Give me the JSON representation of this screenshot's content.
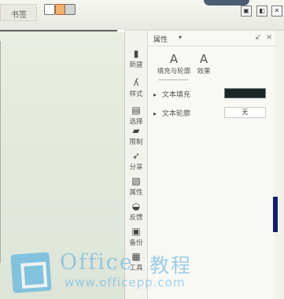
{
  "app": {
    "bookmark_tab": "书签"
  },
  "sidebar_tools": [
    {
      "label": "新建",
      "icon": "new-icon"
    },
    {
      "label": "样式",
      "icon": "style-icon"
    },
    {
      "label": "选择",
      "icon": "select-icon"
    },
    {
      "label": "限制",
      "icon": "restrict-icon"
    },
    {
      "label": "分享",
      "icon": "share-icon"
    },
    {
      "label": "属性",
      "icon": "properties-icon"
    },
    {
      "label": "反馈",
      "icon": "feedback-icon"
    },
    {
      "label": "备份",
      "icon": "backup-icon"
    },
    {
      "label": "工具",
      "icon": "tools-icon"
    }
  ],
  "properties_panel": {
    "title": "属性",
    "dropdown_arrow": "▾",
    "tabs": [
      {
        "glyph": "A",
        "label": "填充与轮廓"
      },
      {
        "glyph": "A",
        "label": "效果"
      }
    ],
    "rows": [
      {
        "label": "文本填充"
      },
      {
        "label": "文本轮廓",
        "value": "无"
      }
    ]
  },
  "colors": {
    "fill_swatch": "#1b2628",
    "scroll_accent": "#0f1f68"
  },
  "watermark": {
    "brand": "Office",
    "suffix": "教程",
    "url": "www.officepp.com"
  }
}
